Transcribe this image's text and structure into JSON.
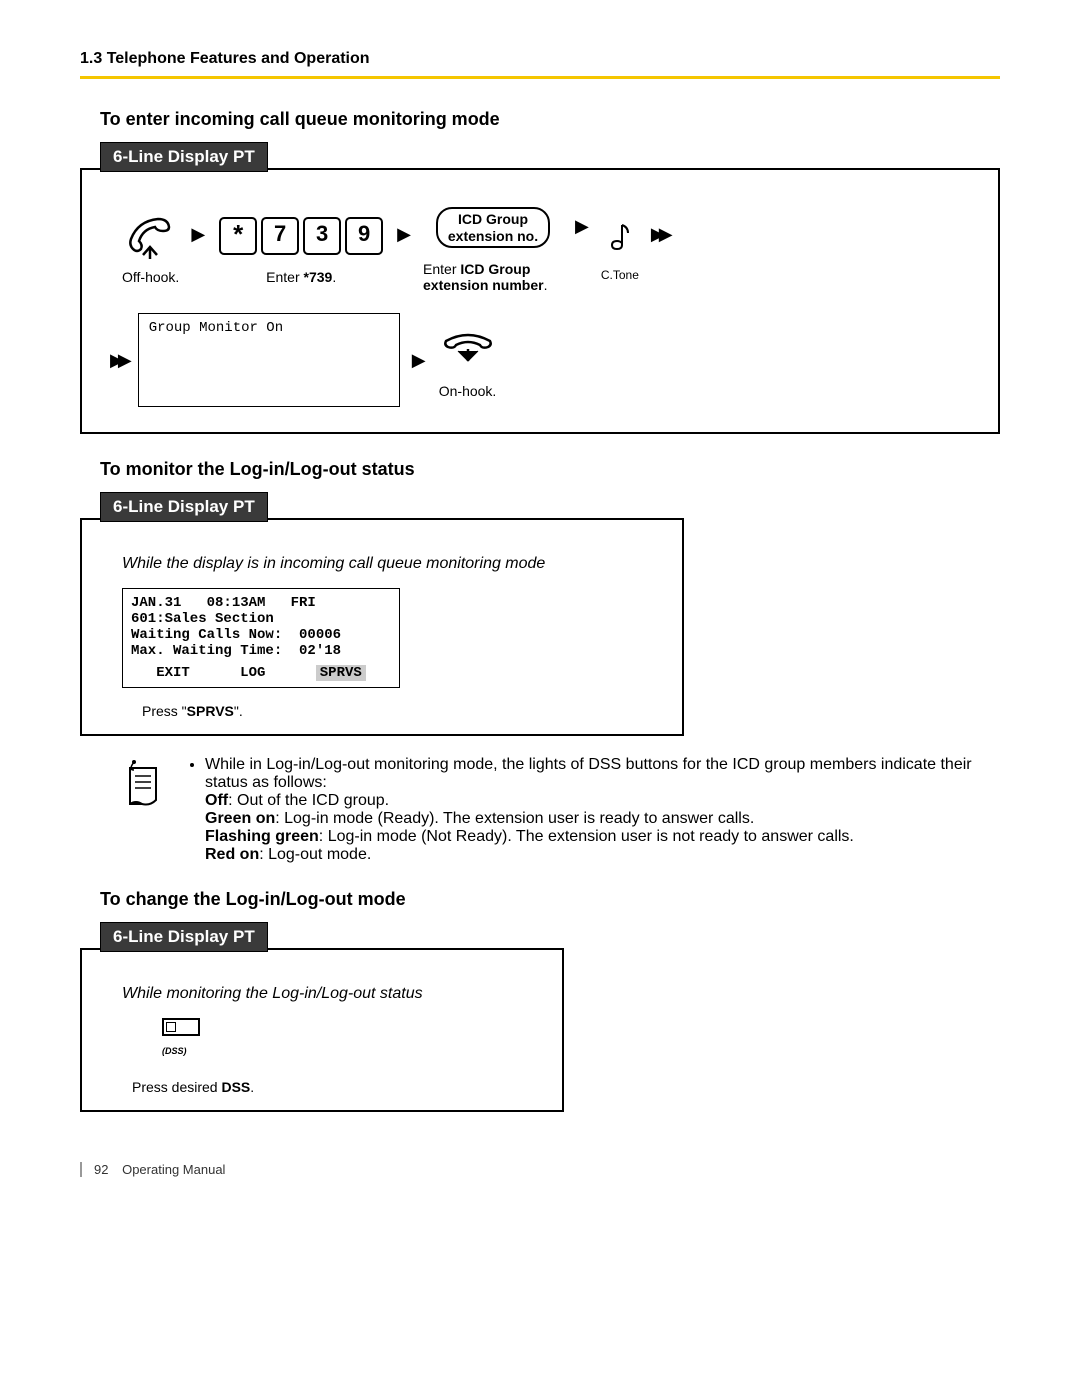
{
  "header": "1.3 Telephone Features and Operation",
  "section1": {
    "title": "To enter incoming call queue monitoring mode",
    "tab": "6-Line Display PT",
    "steps": {
      "offhook": "Off-hook.",
      "enter_code": "Enter    739.",
      "enter_code_bold": "739",
      "icd_line1": "ICD Group",
      "icd_line2": "extension no.",
      "icd_caption_pre": "Enter ",
      "icd_caption_bold": "ICD Group extension number",
      "ctone": "C.Tone",
      "lcd": "Group Monitor On",
      "onhook": "On-hook."
    },
    "keys": [
      "*",
      "7",
      "3",
      "9"
    ]
  },
  "section2": {
    "title": "To monitor the Log-in/Log-out status",
    "tab": "6-Line Display PT",
    "note": "While the display is in incoming call queue monitoring mode",
    "lcd_lines": [
      "JAN.31   08:13AM   FRI",
      "601:Sales Section",
      "Waiting Calls Now:  00006",
      "Max. Waiting Time:  02'18"
    ],
    "softkeys": [
      "EXIT",
      "LOG",
      "SPRVS"
    ],
    "press": "Press \"SPRVS\"."
  },
  "notes": {
    "intro": "While in Log-in/Log-out monitoring mode, the lights of DSS buttons for the ICD group members indicate their status as follows:",
    "items": [
      {
        "b": "Off",
        "t": ": Out of the ICD group."
      },
      {
        "b": "Green on",
        "t": ": Log-in mode (Ready). The extension user is ready to answer calls."
      },
      {
        "b": "Flashing green",
        "t": ": Log-in mode (Not Ready). The extension user is not ready to answer calls."
      },
      {
        "b": "Red on",
        "t": ": Log-out mode."
      }
    ]
  },
  "section3": {
    "title": "To change the Log-in/Log-out mode",
    "tab": "6-Line Display PT",
    "note": "While monitoring the Log-in/Log-out status",
    "dss_label": "(DSS)",
    "press": "Press desired DSS."
  },
  "footer": {
    "page": "92",
    "manual": "Operating Manual"
  }
}
